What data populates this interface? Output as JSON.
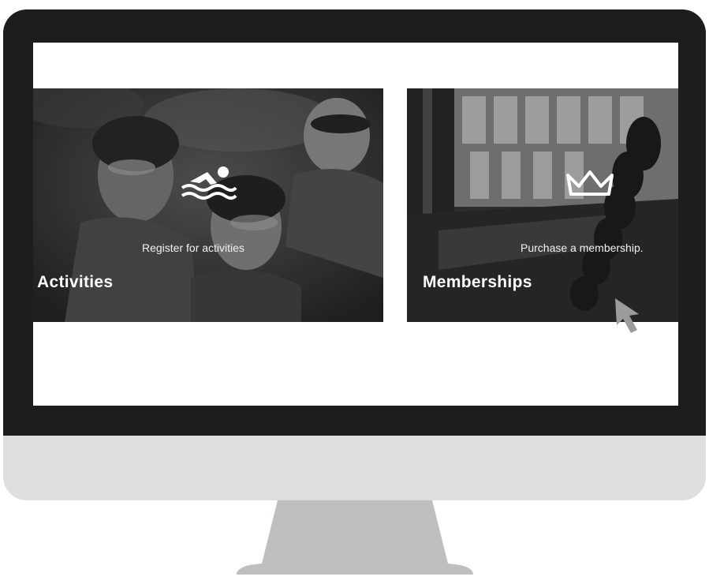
{
  "tiles": [
    {
      "title": "Activities",
      "subtitle": "Register for activities",
      "icon": "swimmer-icon"
    },
    {
      "title": "Memberships",
      "subtitle": "Purchase a membership.",
      "icon": "crown-icon"
    }
  ],
  "icons": {
    "cursor": "mouse-pointer-icon"
  },
  "colors": {
    "bezel": "#1d1d1d",
    "chin": "#dcdedf",
    "stand": "#bdbfc1",
    "screen": "#ffffff",
    "overlay_text": "#ffffff"
  }
}
